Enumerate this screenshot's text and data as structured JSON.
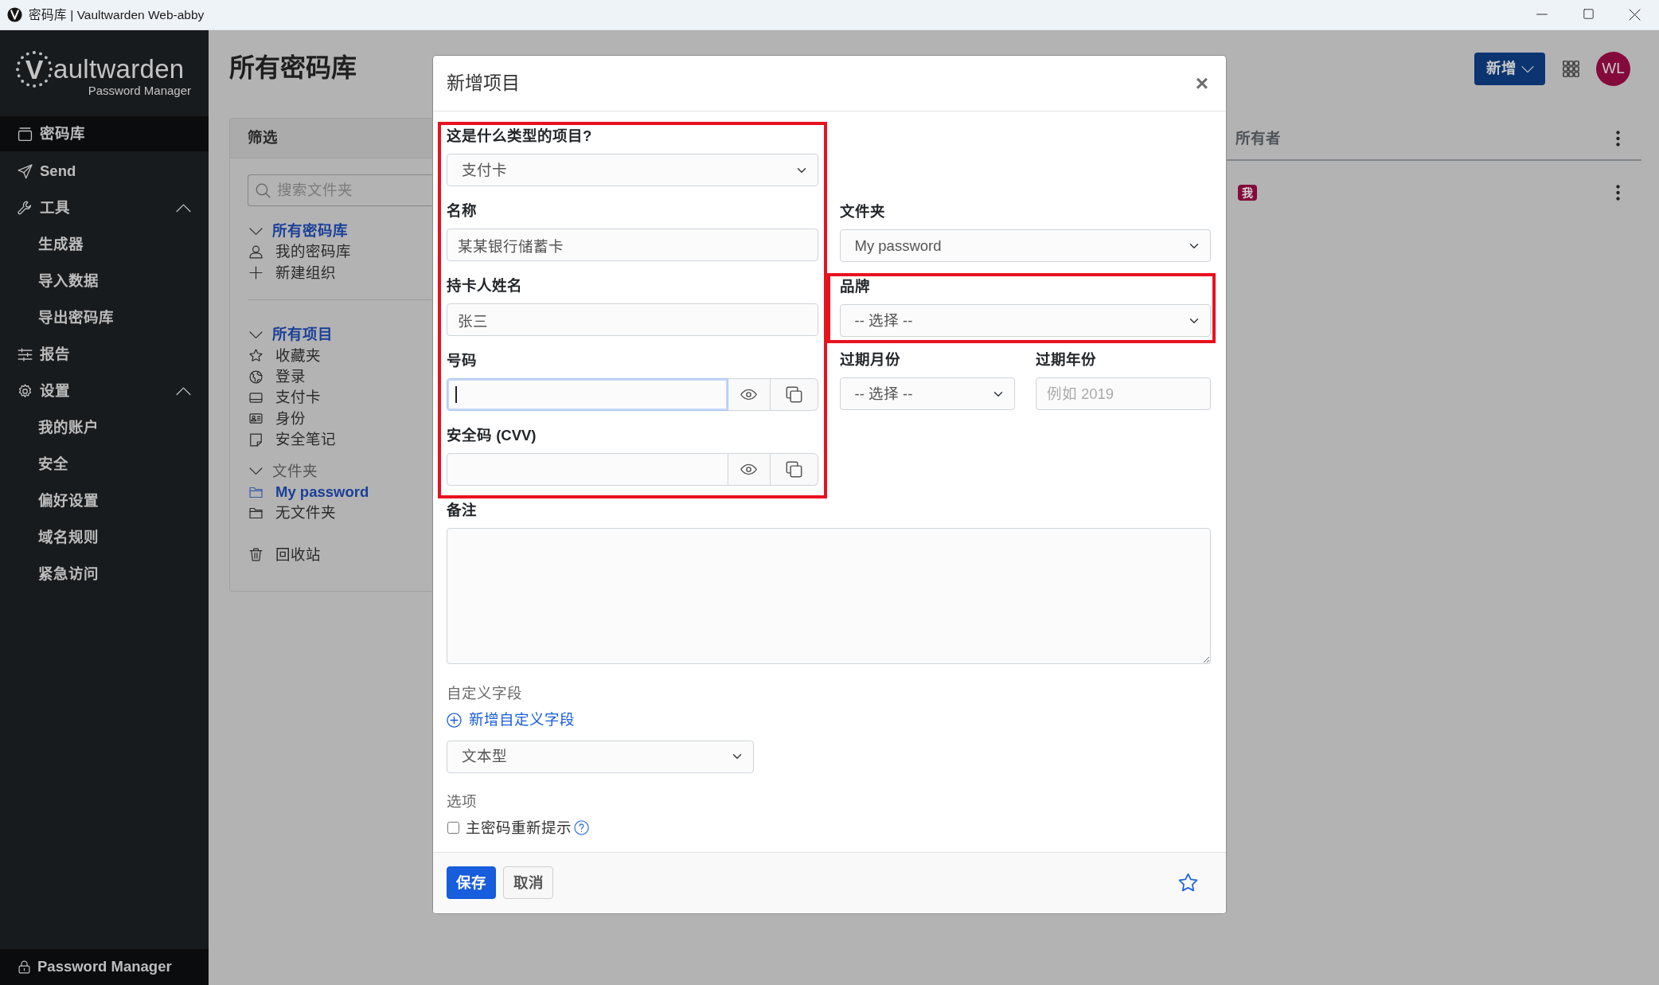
{
  "window": {
    "title": "密码库 | Vaultwarden Web-abby"
  },
  "sidebar": {
    "logo": {
      "mark": "V",
      "name": "aultwarden",
      "subtitle": "Password Manager"
    },
    "items": [
      {
        "label": "密码库",
        "selected": true
      },
      {
        "label": "Send",
        "selected": false
      },
      {
        "label": "工具",
        "selected": false,
        "expanded": true,
        "children": [
          {
            "label": "生成器",
            "selected": false
          },
          {
            "label": "导入数据",
            "selected": false
          },
          {
            "label": "导出密码库",
            "selected": false
          }
        ]
      },
      {
        "label": "报告",
        "selected": false
      },
      {
        "label": "设置",
        "selected": false,
        "expanded": true,
        "children": [
          {
            "label": "我的账户",
            "selected": false
          },
          {
            "label": "安全",
            "selected": false
          },
          {
            "label": "偏好设置",
            "selected": false
          },
          {
            "label": "域名规则",
            "selected": false
          },
          {
            "label": "紧急访问",
            "selected": false
          }
        ]
      }
    ],
    "footer": "Password Manager"
  },
  "header": {
    "title": "所有密码库",
    "new_button": "新增",
    "avatar": "WL"
  },
  "filter": {
    "title": "筛选",
    "search": {
      "placeholder": "搜索文件夹"
    },
    "groups": [
      {
        "label": "所有密码库",
        "selected": true,
        "expanded": true,
        "items": [
          {
            "label": "我的密码库",
            "selected": false
          },
          {
            "label": "新建组织",
            "selected": false
          }
        ]
      },
      {
        "label": "所有项目",
        "selected": true,
        "expanded": true,
        "items": [
          {
            "label": "收藏夹",
            "selected": false
          },
          {
            "label": "登录",
            "selected": false
          },
          {
            "label": "支付卡",
            "selected": false
          },
          {
            "label": "身份",
            "selected": false
          },
          {
            "label": "安全笔记",
            "selected": false
          }
        ]
      },
      {
        "label": "文件夹",
        "selected": false,
        "expanded": true,
        "items": [
          {
            "label": "My password",
            "selected": true
          },
          {
            "label": "无文件夹",
            "selected": false
          }
        ]
      }
    ],
    "trash": {
      "label": "回收站",
      "selected": false
    }
  },
  "vault_list": {
    "columns": [
      {
        "label": "所有者"
      }
    ],
    "rows": [
      {
        "owner": "我"
      }
    ]
  },
  "modal": {
    "title": "新增项目",
    "close": "×",
    "left_column": {
      "highlighted": true,
      "fields": [
        {
          "label": "这是什么类型的项目?",
          "kind": "select",
          "value": "支付卡",
          "focused": false
        },
        {
          "label": "名称",
          "kind": "text",
          "value": "某某银行储蓄卡",
          "focused": false
        },
        {
          "label": "持卡人姓名",
          "kind": "text",
          "value": "张三",
          "focused": false
        },
        {
          "label": "号码",
          "kind": "secret",
          "focused": true
        },
        {
          "label": "安全码 (CVV)",
          "kind": "secret",
          "focused": false
        }
      ]
    },
    "right_column": [
      {
        "highlighted": false,
        "fields": [
          {
            "label": "文件夹",
            "kind": "select",
            "value": "My password",
            "focused": false
          }
        ]
      },
      {
        "highlighted": true,
        "fields": [
          {
            "label": "品牌",
            "kind": "select",
            "value": "-- 选择 --",
            "focused": false
          }
        ]
      },
      {
        "highlighted": false,
        "fields": [
          {
            "label": "过期月份",
            "kind": "select",
            "value": "-- 选择 --",
            "focused": false
          },
          {
            "label": "过期年份",
            "kind": "text",
            "placeholder": "例如 2019",
            "focused": false
          }
        ]
      }
    ],
    "notes": {
      "label": "备注"
    },
    "custom_fields": {
      "heading": "自定义字段",
      "add_link": "新增自定义字段",
      "type_select": "文本型"
    },
    "options": {
      "heading": "选项",
      "reprompt": {
        "label": "主密码重新提示",
        "checked": false
      }
    },
    "footer": {
      "buttons": [
        {
          "label": "保存",
          "kind": "primary"
        },
        {
          "label": "取消",
          "kind": "secondary"
        }
      ],
      "favorite": false
    }
  }
}
